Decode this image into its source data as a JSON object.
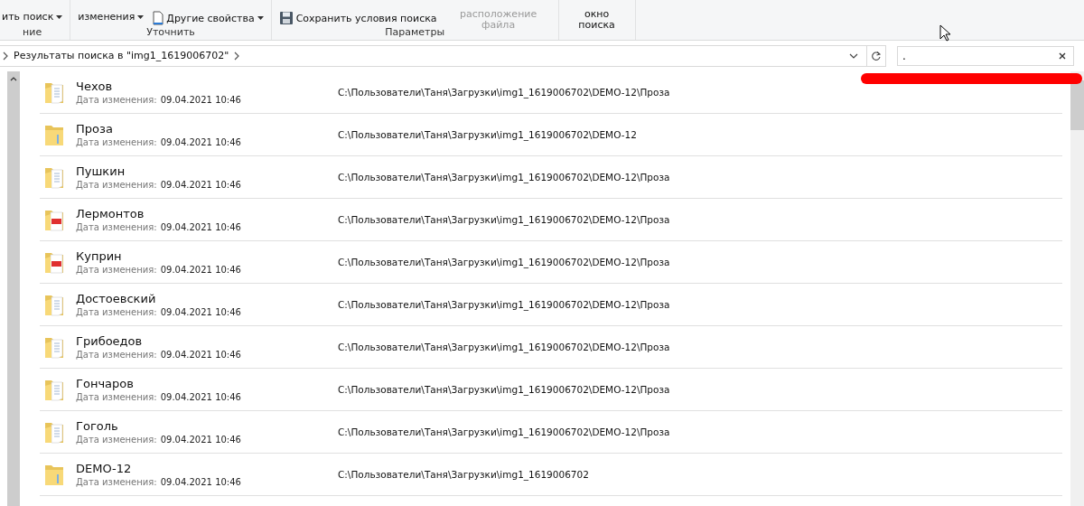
{
  "ribbon": {
    "groups": [
      {
        "label": "ние",
        "items": [
          {
            "kind": "dropdown",
            "label": "ить поиск"
          }
        ]
      },
      {
        "label": "Уточнить",
        "items": [
          {
            "kind": "dropdown-two",
            "label": "изменения"
          },
          {
            "kind": "dropdown-doc",
            "label": "Другие свойства"
          }
        ]
      },
      {
        "label": "Параметры",
        "items": [
          {
            "kind": "save",
            "label": "Сохранить условия поиска"
          },
          {
            "kind": "big-disabled",
            "label": "расположение файла"
          }
        ]
      },
      {
        "items": [
          {
            "kind": "big",
            "label": "окно поиска"
          }
        ]
      }
    ]
  },
  "address_bar": {
    "path": "Результаты поиска в \"img1_1619006702\""
  },
  "search": {
    "value": "."
  },
  "results": [
    {
      "kind": "document",
      "name": "Чехов",
      "date_label": "Дата изменения:",
      "date": "09.04.2021 10:46",
      "path": "C:\\Пользователи\\Таня\\Загрузки\\img1_1619006702\\DEMO-12\\Проза"
    },
    {
      "kind": "folder",
      "name": "Проза",
      "date_label": "Дата изменения:",
      "date": "09.04.2021 10:46",
      "path": "C:\\Пользователи\\Таня\\Загрузки\\img1_1619006702\\DEMO-12"
    },
    {
      "kind": "document",
      "name": "Пушкин",
      "date_label": "Дата изменения:",
      "date": "09.04.2021 10:46",
      "path": "C:\\Пользователи\\Таня\\Загрузки\\img1_1619006702\\DEMO-12\\Проза"
    },
    {
      "kind": "pdf",
      "name": "Лермонтов",
      "date_label": "Дата изменения:",
      "date": "09.04.2021 10:46",
      "path": "C:\\Пользователи\\Таня\\Загрузки\\img1_1619006702\\DEMO-12\\Проза"
    },
    {
      "kind": "pdf",
      "name": "Куприн",
      "date_label": "Дата изменения:",
      "date": "09.04.2021 10:46",
      "path": "C:\\Пользователи\\Таня\\Загрузки\\img1_1619006702\\DEMO-12\\Проза"
    },
    {
      "kind": "document",
      "name": "Достоевский",
      "date_label": "Дата изменения:",
      "date": "09.04.2021 10:46",
      "path": "C:\\Пользователи\\Таня\\Загрузки\\img1_1619006702\\DEMO-12\\Проза"
    },
    {
      "kind": "document",
      "name": "Грибоедов",
      "date_label": "Дата изменения:",
      "date": "09.04.2021 10:46",
      "path": "C:\\Пользователи\\Таня\\Загрузки\\img1_1619006702\\DEMO-12\\Проза"
    },
    {
      "kind": "document",
      "name": "Гончаров",
      "date_label": "Дата изменения:",
      "date": "09.04.2021 10:46",
      "path": "C:\\Пользователи\\Таня\\Загрузки\\img1_1619006702\\DEMO-12\\Проза"
    },
    {
      "kind": "document",
      "name": "Гоголь",
      "date_label": "Дата изменения:",
      "date": "09.04.2021 10:46",
      "path": "C:\\Пользователи\\Таня\\Загрузки\\img1_1619006702\\DEMO-12\\Проза"
    },
    {
      "kind": "folder",
      "name": "DEMO-12",
      "date_label": "Дата изменения:",
      "date": "09.04.2021 10:46",
      "path": "C:\\Пользователи\\Таня\\Загрузки\\img1_1619006702"
    }
  ]
}
